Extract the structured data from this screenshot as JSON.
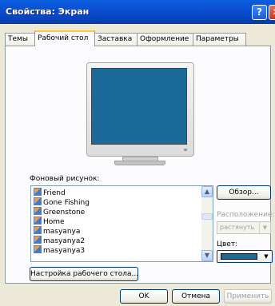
{
  "window": {
    "title": "Свойства: Экран",
    "help_glyph": "?",
    "close_glyph": "✕"
  },
  "tabs": [
    {
      "label": "Темы",
      "active": false
    },
    {
      "label": "Рабочий стол",
      "active": true
    },
    {
      "label": "Заставка",
      "active": false
    },
    {
      "label": "Оформление",
      "active": false
    },
    {
      "label": "Параметры",
      "active": false
    }
  ],
  "desktop": {
    "monitor_screen_color": "#1b6a9a",
    "background_label": "Фоновый рисунок:",
    "backgrounds": [
      {
        "name": "Friend",
        "icon": "image-icon"
      },
      {
        "name": "Gone Fishing",
        "icon": "image-icon"
      },
      {
        "name": "Greenstone",
        "icon": "image-icon"
      },
      {
        "name": "Home",
        "icon": "image-icon"
      },
      {
        "name": "masyanya",
        "icon": "image-icon"
      },
      {
        "name": "masyanya2",
        "icon": "image-icon"
      },
      {
        "name": "masyanya3",
        "icon": "image-icon"
      }
    ],
    "browse_label": "Обзор...",
    "position_label": "Расположение:",
    "position_value": "растянуть",
    "color_label": "Цвет:",
    "color_value": "#1b6a9a",
    "customize_label": "Настройка рабочего стола..."
  },
  "footer": {
    "ok_label": "OK",
    "cancel_label": "Отмена",
    "apply_label": "Применить"
  }
}
